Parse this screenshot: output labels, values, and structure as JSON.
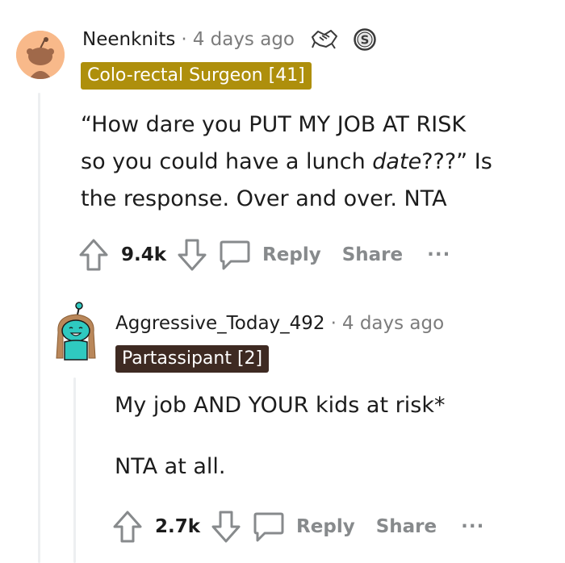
{
  "comment1": {
    "username": "Neenknits",
    "separator": "·",
    "time": "4 days ago",
    "flair": "Colo-rectal Surgeon [41]",
    "flair_color": "#ae8f0c",
    "body_line1": "“How dare you PUT MY JOB AT RISK",
    "body_line2_prefix": "so you could have a lunch ",
    "body_line2_italic": "date",
    "body_line2_suffix": "???” Is",
    "body_line3": "the response. Over and over. NTA",
    "votes": "9.4k",
    "reply_label": "Reply",
    "share_label": "Share",
    "more_label": "···"
  },
  "comment2": {
    "username": "Aggressive_Today_492",
    "separator": "·",
    "time": "4 days ago",
    "flair": "Partassipant [2]",
    "flair_color": "#3e2a22",
    "body_line1": "My job AND YOUR kids at risk*",
    "body_line2": "NTA at all.",
    "votes": "2.7k",
    "reply_label": "Reply",
    "share_label": "Share",
    "more_label": "···"
  },
  "icons": {
    "avatar1": "snoo-avatar-icon",
    "avatar2": "snoo-avatar-icon",
    "award1": "handshake-award-icon",
    "award2": "silver-award-icon",
    "upvote": "upvote-icon",
    "downvote": "downvote-icon",
    "comment": "comment-icon"
  }
}
